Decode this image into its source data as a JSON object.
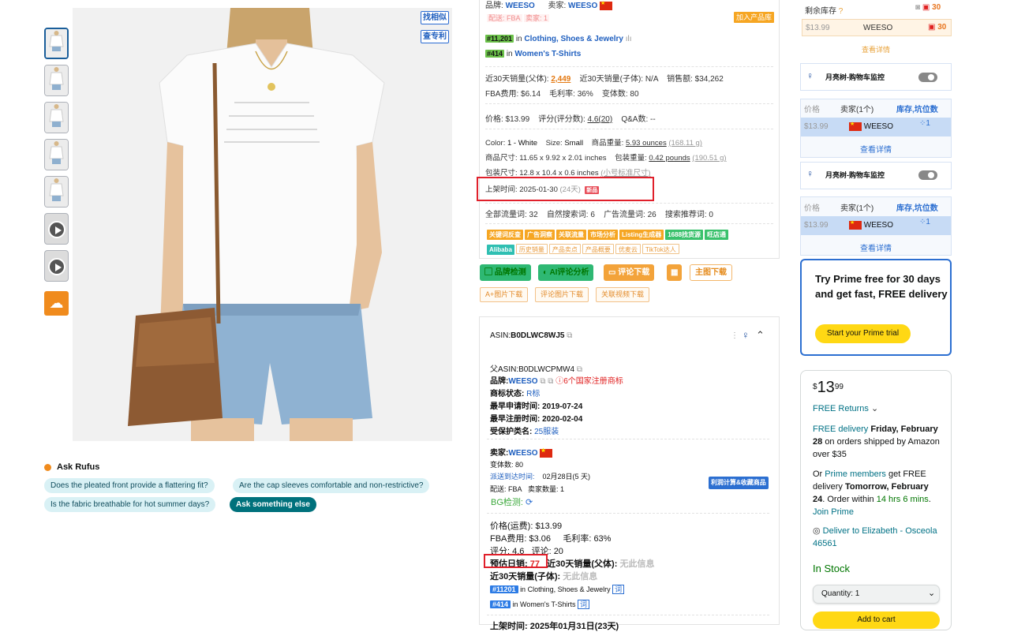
{
  "side_buttons": {
    "find_similar": "找相似",
    "check_patent": "查专利"
  },
  "rufus": {
    "title": "Ask Rufus",
    "chips": [
      "Does the pleated front provide a flattering fit?",
      "Are the cap sleeves comfortable and non-restrictive?",
      "Is the fabric breathable for hot summer days?",
      "Ask something else"
    ]
  },
  "mid": {
    "brand_label": "品牌:",
    "brand": "WEESO",
    "seller_label": "卖家:",
    "seller": "WEESO",
    "fba_tag": "配送: FBA",
    "seller_count": "卖家: 1",
    "add_product": "加入产品库",
    "rank1_badge": "#11,201",
    "rank1_text": "in",
    "rank1_cat": "Clothing, Shoes & Jewelry",
    "rank2_badge": "#414",
    "rank2_text": "in",
    "rank2_cat": "Women's T-Shirts",
    "sales_parent_label": "近30天销量(父体):",
    "sales_parent": "2,449",
    "sales_child": "近30天销量(子体): N/A",
    "revenue": "销售额: $34,262",
    "fba_fee": "FBA费用: $6.14",
    "margin": "毛利率: 36%",
    "variants": "变体数: 80",
    "price": "价格: $13.99",
    "rating_label": "评分(评分数):",
    "rating": "4.6(20)",
    "qa": "Q&A数: --",
    "color_label": "Color:",
    "color": "1 - White",
    "size_label": "Size:",
    "size": "Small",
    "weight_label": "商品重量:",
    "weight": "5.93 ounces",
    "weight_g": "(168.11 g)",
    "dims": "商品尺寸: 11.65 x 9.92 x 2.01 inches",
    "pkg_weight_label": "包装重量:",
    "pkg_weight": "0.42 pounds",
    "pkg_weight_g": "(190.51 g)",
    "pkg_dims": "包装尺寸: 12.8 x 10.4 x 0.6 inches",
    "pkg_dims_std": "(小号标准尺寸)",
    "listed_label": "上架时间: 2025-01-30",
    "listed_days": "(24天)",
    "listed_badge": "新品",
    "traffic_all": "全部流量词: 32",
    "traffic_natural": "自然搜索词: 6",
    "traffic_ad": "广告流量词: 26",
    "traffic_rec": "搜索推荐词: 0",
    "tags_row1": [
      "关键词反查",
      "广告洞察",
      "关联流量",
      "市场分析",
      "Listing生成器",
      "1688找货源",
      "旺店通"
    ],
    "tags_row2": [
      "Alibaba",
      "历史销量",
      "产品卖点",
      "产品概要",
      "优麦云",
      "TikTok达人"
    ],
    "action_buttons": [
      "品牌检测",
      "AI评论分析",
      "评论下载",
      "主图下载"
    ],
    "small_buttons": [
      "A+图片下载",
      "评论图片下载",
      "关联视频下载"
    ]
  },
  "asin_card": {
    "asin_label": "ASIN:",
    "asin": "B0DLWC8WJ5",
    "parent_label": "父ASIN:",
    "parent": "B0DLWCPMW4",
    "brand_label": "品牌:",
    "brand": "WEESO",
    "trademark_warn": "6个国家注册商标",
    "tm_status_label": "商标状态:",
    "tm_status": "R标",
    "apply_date": "最早申请时间: 2019-07-24",
    "reg_date": "最早注册时间: 2020-02-04",
    "protect_label": "受保护类名:",
    "protect": "25服装",
    "seller_label": "卖家:",
    "seller": "WEESO",
    "variants": "变体数: 80",
    "delivery_label": "派送到达时间:",
    "delivery": "02月28日(5 天)",
    "shipping": "配送: FBA",
    "seller_count": "卖家数量: 1",
    "calc_button": "利润计算&收藏商品",
    "bg_label": "BG检测:",
    "price": "价格(运费): $13.99",
    "fba": "FBA费用: $3.06",
    "margin": "毛利率: 63%",
    "rating": "评分: 4.6",
    "reviews": "评论: 20",
    "daily_label": "预估日销:",
    "daily": "77",
    "parent_sales_label": "近30天销量(父体):",
    "no_info": "无此信息",
    "child_sales_label": "近30天销量(子体):",
    "rank1": "#11201",
    "rank1_cat": "in Clothing, Shoes & Jewelry",
    "rank2": "#414",
    "rank2_cat": "in Women's T-Shirts",
    "listed_cut": "上架时间: 2025年01月31日(23天)"
  },
  "right": {
    "stock_label": "剩余库存",
    "stock_count": "30",
    "row_price": "$13.99",
    "row_seller": "WEESO",
    "row_count": "30",
    "detail_link": "查看详情",
    "monitor_title": "月亮树-购物车监控",
    "tbl_price": "价格",
    "tbl_seller": "卖家(1个)",
    "tbl_stock": "库存,坑位数",
    "tbl_row_price": "$13.99",
    "tbl_row_seller": "WEESO",
    "tbl_row_stock": "1",
    "detail_link2": "查看详情",
    "monitor_title2": "月亮树-购物车监控",
    "detail_link3": "查看详情"
  },
  "prime": {
    "text": "Try Prime free for 30 days and get fast, FREE delivery",
    "button": "Start your Prime trial"
  },
  "buybox": {
    "currency": "$",
    "dollars": "13",
    "cents": "99",
    "returns": "FREE Returns",
    "delivery_line1_link": "FREE delivery",
    "delivery_line1_date": "Friday, February 28",
    "delivery_line1_rest": "on orders shipped by Amazon over $35",
    "prime_or": "Or",
    "prime_link": "Prime members",
    "prime_rest": "get FREE delivery",
    "prime_date": "Tomorrow, February 24",
    "order_within": ". Order within",
    "countdown": "14 hrs 6 mins",
    "join": "Join Prime",
    "deliver_to": "Deliver to Elizabeth - Osceola 46561",
    "stock": "In Stock",
    "quantity": "Quantity: 1",
    "add_to_cart": "Add to cart"
  }
}
